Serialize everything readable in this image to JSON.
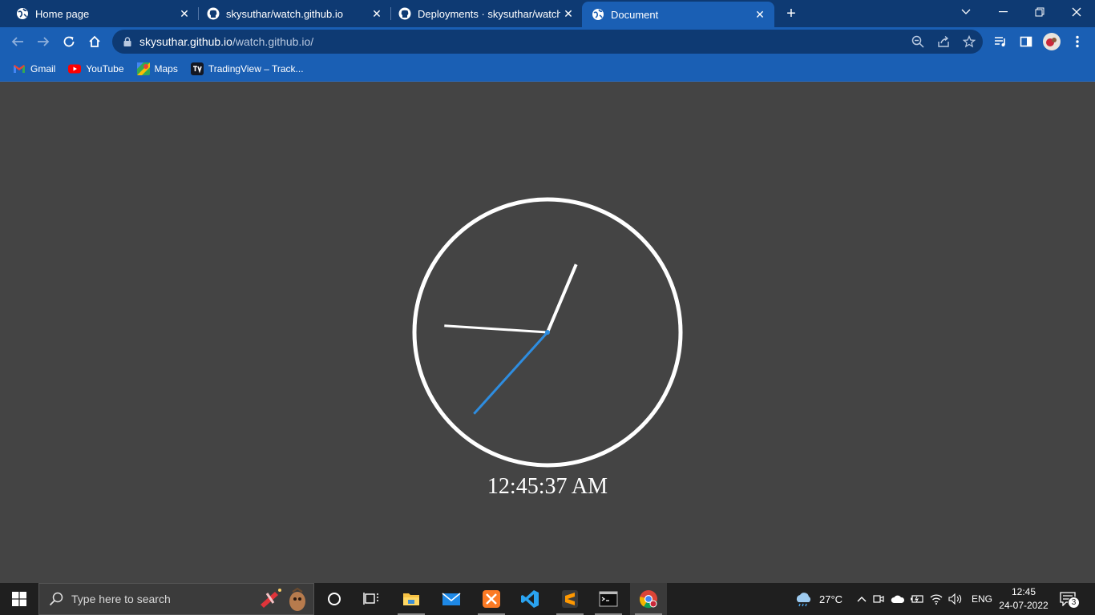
{
  "tabs": [
    {
      "title": "Home page",
      "icon": "globe-icon"
    },
    {
      "title": "skysuthar/watch.github.io",
      "icon": "github-icon"
    },
    {
      "title": "Deployments · skysuthar/watch.g",
      "icon": "github-icon"
    },
    {
      "title": "Document",
      "icon": "globe-icon",
      "active": true
    }
  ],
  "address": {
    "host": "skysuthar.github.io",
    "path": "/watch.github.io/"
  },
  "bookmarks": [
    {
      "label": "Gmail",
      "icon": "gmail-icon"
    },
    {
      "label": "YouTube",
      "icon": "youtube-icon"
    },
    {
      "label": "Maps",
      "icon": "maps-icon"
    },
    {
      "label": "TradingView – Track...",
      "icon": "tradingview-icon"
    }
  ],
  "page": {
    "time": "12:45:37 AM",
    "clock": {
      "face_color": "#ffffff",
      "hour_hand_color": "#ffffff",
      "minute_hand_color": "#ffffff",
      "second_hand_color": "#2e8de0",
      "hours": 12,
      "minutes": 45,
      "seconds": 37
    }
  },
  "taskbar": {
    "search_placeholder": "Type here to search",
    "weather": "27°C",
    "language": "ENG",
    "time": "12:45",
    "date": "24-07-2022",
    "notifications": "3"
  }
}
